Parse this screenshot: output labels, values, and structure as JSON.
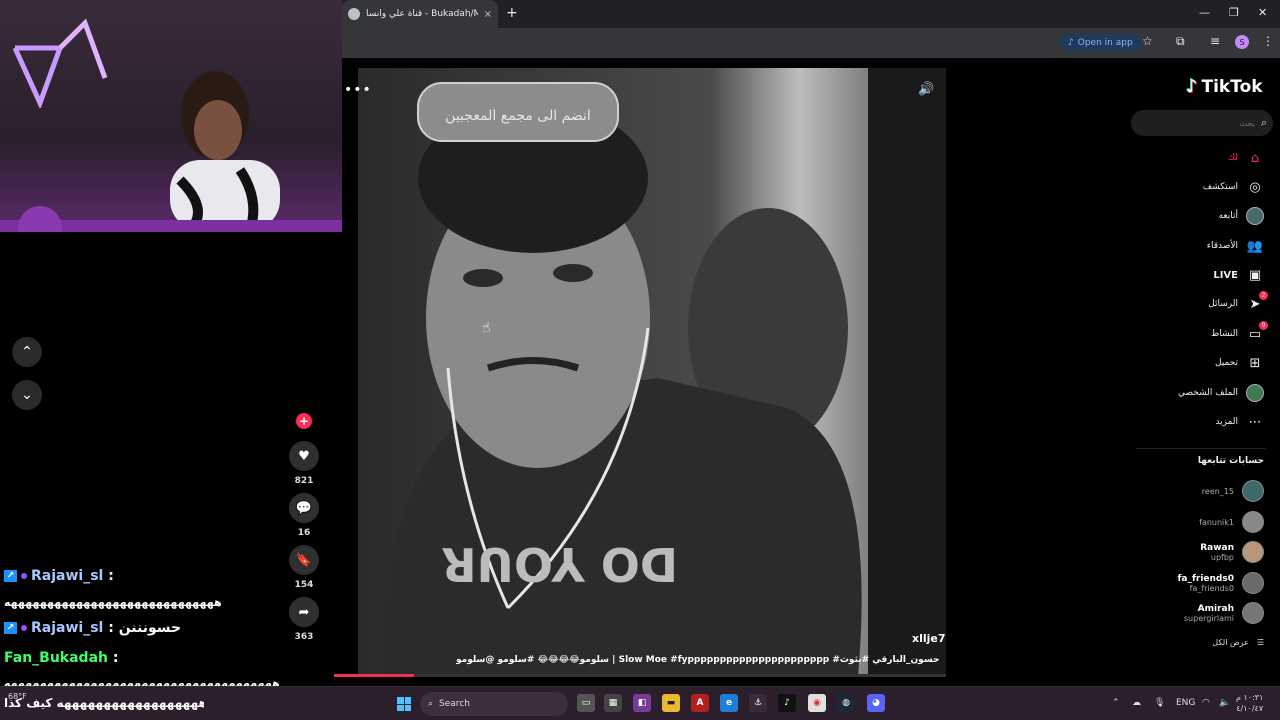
{
  "browser": {
    "tab_title": "قناة علي وانسا - Bukadah/M3tz",
    "tab_close": "×",
    "new_tab": "+",
    "open_in_app": "Open in app",
    "profile_initial": "S"
  },
  "video": {
    "author": "xllje7",
    "caption": "سلومو😂😂😂😂 #سلومو @سلومو | Slow Moe #fypppppppppppppppppppppp #حسون_البارقي #بثوث #explore",
    "progress_fraction": 0.13,
    "hat_text": "انضم الى مجمع المعجبين"
  },
  "actions": {
    "likes": "821",
    "comments": "16",
    "saves": "154",
    "shares": "363"
  },
  "chat": [
    {
      "user": "Rajawi_sl",
      "sep": " :",
      "text": "",
      "color": "blue"
    },
    {
      "message": "هههههههههههههههههههههههههههههه"
    },
    {
      "user": "Rajawi_sl",
      "sep": " : ",
      "text": "حسونننن",
      "color": "blue"
    },
    {
      "user": "Fan_Bukadah",
      "sep": " :",
      "text": "",
      "color": "green"
    },
    {
      "message": "هههههههههههههههههههههههههههههههههههههه"
    },
    {
      "message": "ههههههههههههههههههه كيف كذا"
    }
  ],
  "sidebar": {
    "logo": "TikTok",
    "search_placeholder": "بحث",
    "nav": [
      {
        "label": "لك",
        "icon": "home-icon"
      },
      {
        "label": "استكشف",
        "icon": "compass-icon"
      },
      {
        "label": "أتابعه",
        "icon": "following-icon"
      },
      {
        "label": "الأصدقاء",
        "icon": "friends-icon"
      },
      {
        "label": "LIVE",
        "icon": "live-icon"
      },
      {
        "label": "الرسائل",
        "icon": "messages-icon",
        "badge": "2"
      },
      {
        "label": "النشاط",
        "icon": "activity-icon",
        "badge": "9"
      },
      {
        "label": "تحميل",
        "icon": "upload-icon"
      },
      {
        "label": "الملف الشخصي",
        "icon": "profile-icon"
      },
      {
        "label": "المزيد",
        "icon": "more-icon"
      }
    ],
    "following_title": "حسابات تتابعها",
    "following": [
      {
        "name": "",
        "handle": "reen_15"
      },
      {
        "name": "",
        "handle": "fanunik1"
      },
      {
        "name": "Rawan",
        "handle": "upfbp"
      },
      {
        "name": "fa_friends0",
        "handle": "fa_friends0"
      },
      {
        "name": "Amirah",
        "handle": "supergirlami"
      }
    ],
    "see_all": "عرض الكل"
  },
  "taskbar": {
    "weather": "68°F",
    "search": "Search",
    "lang": "ENG",
    "time": "١٠:٣١ م",
    "date": "٤/١٠/٤٧"
  },
  "colors": {
    "accent": "#fe2c55",
    "cyan": "#25f4ee",
    "chat_blue": "#a8c7ff",
    "chat_green": "#3cff6a"
  }
}
